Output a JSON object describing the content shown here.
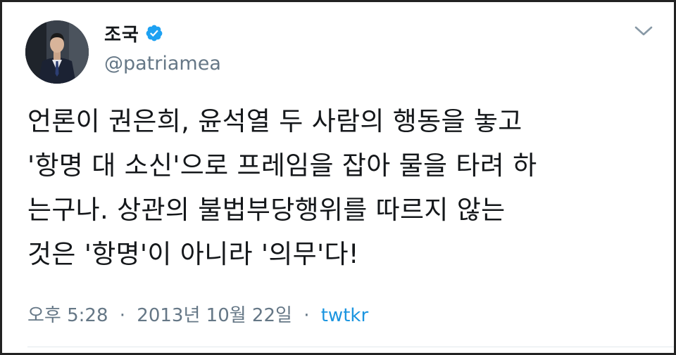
{
  "tweet": {
    "author": {
      "display_name": "조국",
      "handle": "@patriamea",
      "verified_icon": "verified-badge-icon",
      "avatar": "profile-photo"
    },
    "menu_icon": "chevron-down-icon",
    "text": "언론이 권은희, 윤석열 두 사람의 행동을 놓고\n'항명 대 소신'으로 프레임을 잡아 물을 타려 하\n는구나. 상관의 불법부당행위를 따르지 않는\n것은 '항명'이 아니라 '의무'다!",
    "time": "오후 5:28",
    "separator": "·",
    "date": "2013년 10월 22일",
    "source": "twtkr"
  },
  "colors": {
    "text": "#14171a",
    "secondary": "#657786",
    "link": "#1b95e0",
    "verified": "#1da1f2"
  }
}
